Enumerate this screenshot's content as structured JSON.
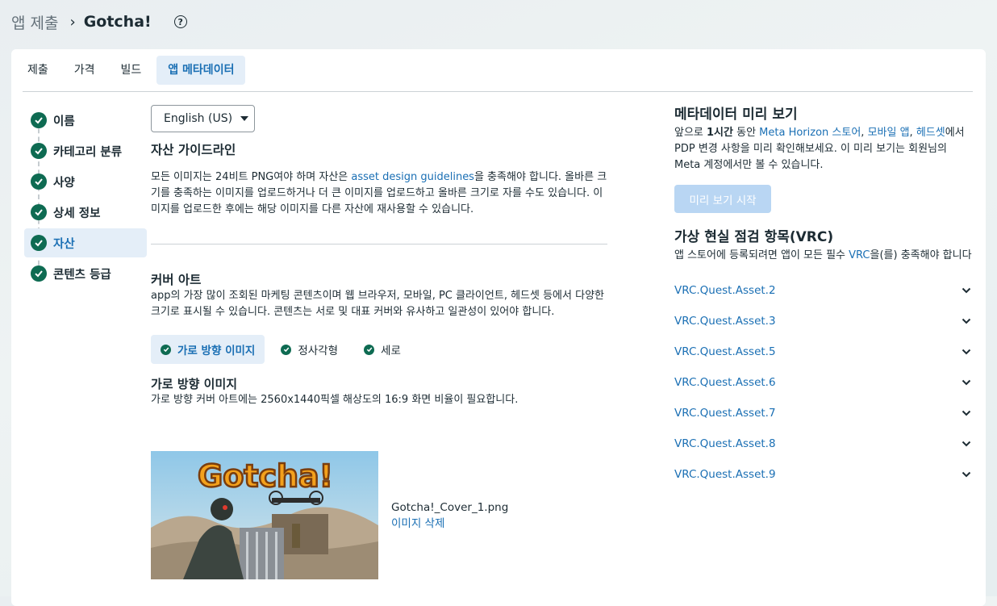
{
  "breadcrumb": {
    "parent": "앱 제출",
    "current": "Gotcha!",
    "help_icon": "question-circle-icon"
  },
  "tabs": [
    {
      "label": "제출"
    },
    {
      "label": "가격"
    },
    {
      "label": "빌드"
    },
    {
      "label": "앱 메타데이터",
      "active": true
    }
  ],
  "steps": [
    {
      "label": "이름"
    },
    {
      "label": "카테고리 분류"
    },
    {
      "label": "사양"
    },
    {
      "label": "상세 정보"
    },
    {
      "label": "자산",
      "active": true
    },
    {
      "label": "콘텐츠 등급"
    }
  ],
  "main": {
    "language": "English (US)",
    "guidelines_title": "자산 가이드라인",
    "guidelines_text_1": "모든 이미지는 24비트 PNG여야 하며 자산은 ",
    "guidelines_link": "asset design guidelines",
    "guidelines_text_2": "을 충족해야 합니다. 올바른 크기를 충족하는 이미지를 업로드하거나 더 큰 이미지를 업로드하고 올바른 크기로 자를 수도 있습니다. 이미지를 업로드한 후에는 해당 이미지를 다른 자산에 재사용할 수 있습니다.",
    "cover_title": "커버 아트",
    "cover_text": "app의 가장 많이 조회된 마케팅 콘텐츠이며 웹 브라우저, 모바일, PC 클라이언트, 헤드셋 등에서 다양한 크기로 표시될 수 있습니다. 콘텐츠는 서로 및 대표 커버와 유사하고 일관성이 있어야 합니다.",
    "subtabs": [
      {
        "label": "가로 방향 이미지",
        "active": true
      },
      {
        "label": "정사각형"
      },
      {
        "label": "세로"
      }
    ],
    "landscape_title": "가로 방향 이미지",
    "landscape_text": "가로 방향 커버 아트에는 2560x1440픽셀 해상도의 16:9 화면 비율이 필요합니다.",
    "image_logo_text": "Gotcha!",
    "file_name": "Gotcha!_Cover_1.png",
    "delete_label": "이미지 삭제"
  },
  "preview": {
    "title": "메타데이터 미리 보기",
    "text_1": "앞으로 ",
    "text_bold": "1시간",
    "text_2": " 동안 ",
    "link_1": "Meta Horizon 스토어",
    "comma_1": ", ",
    "link_2": "모바일 앱",
    "comma_2": ", ",
    "link_3": "헤드셋",
    "text_3": "에서 PDP 변경 사항을 미리 확인해보세요. 이 미리 보기는 회원님의 Meta 계정에서만 볼 수 있습니다.",
    "button": "미리 보기 시작"
  },
  "vrc": {
    "title": "가상 현실 점검 항목(VRC)",
    "text_1": "앱 스토어에 등록되려면 앱이 모든 필수 ",
    "link": "VRC",
    "text_2": "을(를) 충족해야 합니다",
    "items": [
      "VRC.Quest.Asset.2",
      "VRC.Quest.Asset.3",
      "VRC.Quest.Asset.5",
      "VRC.Quest.Asset.6",
      "VRC.Quest.Asset.7",
      "VRC.Quest.Asset.8",
      "VRC.Quest.Asset.9"
    ]
  },
  "colors": {
    "accent": "#1a6fb4",
    "success": "#0e6b52",
    "active_bg": "#e4eef8",
    "disabled_button": "#b9d6f3"
  }
}
